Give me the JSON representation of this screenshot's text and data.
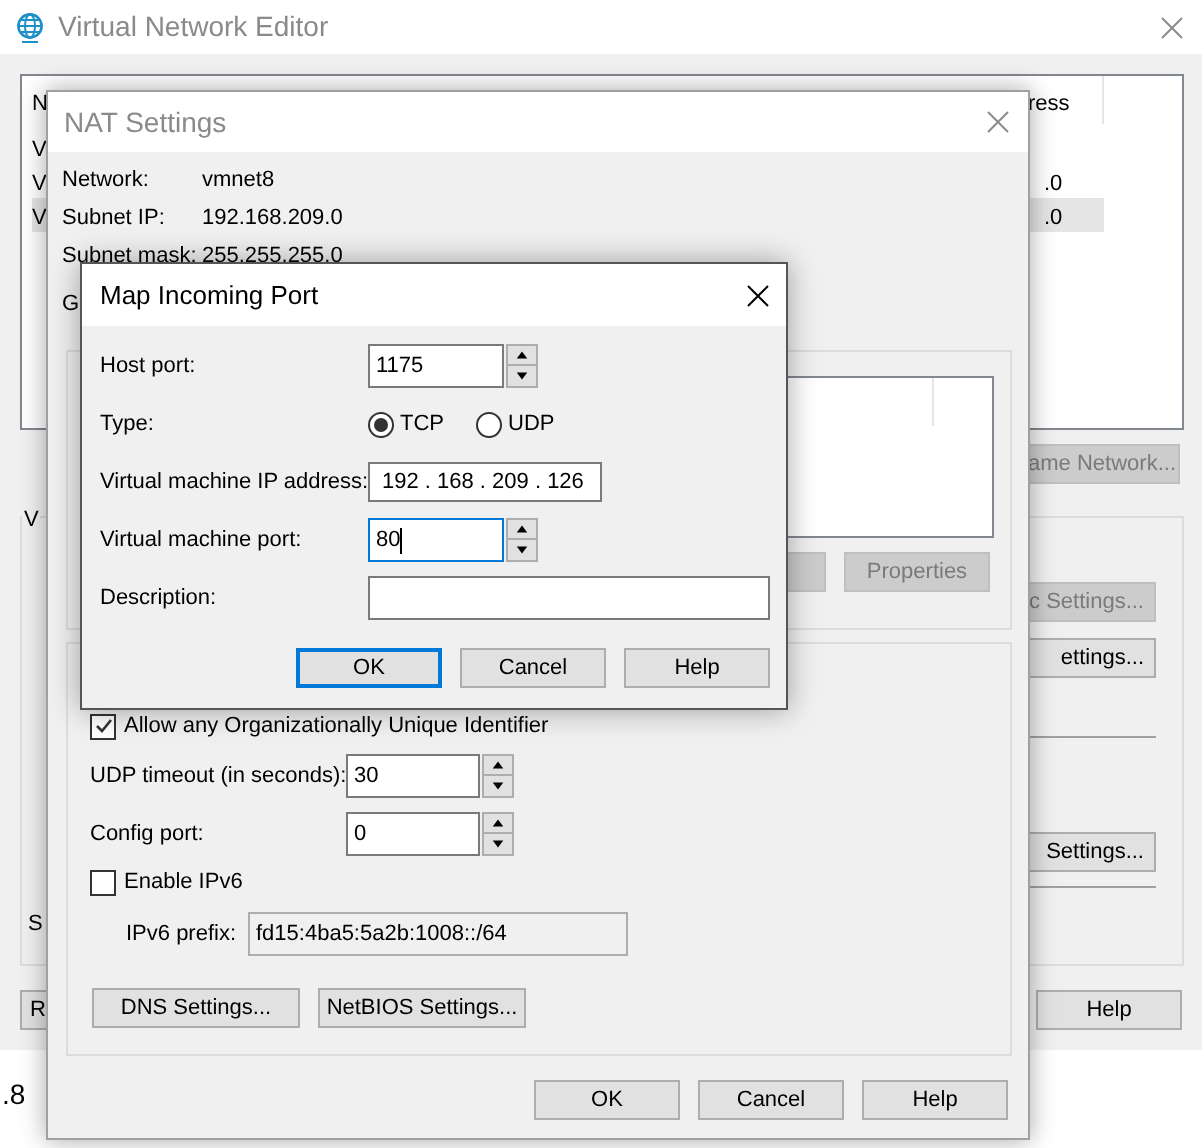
{
  "editor_window": {
    "title": "Virtual Network Editor",
    "list": {
      "column_1": "N",
      "column_4": "ress",
      "rows": [
        {
          "column_1": "V",
          "selected": false
        },
        {
          "column_1": "V",
          "column_4": ".0",
          "selected": false
        },
        {
          "column_1": "V",
          "column_4": ".0",
          "selected": true
        }
      ]
    },
    "rename_button": {
      "label": "ame Network...",
      "disabled": true
    },
    "group_label": "V",
    "group_buttons": [
      {
        "label": "c Settings...",
        "disabled": true
      },
      {
        "label": "ettings...",
        "disabled": false
      },
      {
        "label": "Settings...",
        "disabled": false
      }
    ],
    "side_label": "S",
    "left_button": "R",
    "help_button": "Help"
  },
  "desktop_text": ".8",
  "nat_window": {
    "title": "NAT Settings",
    "info": [
      {
        "label": "Network:",
        "value": "vmnet8"
      },
      {
        "label": "Subnet IP:",
        "value": "192.168.209.0"
      },
      {
        "label": "Subnet mask:",
        "value": "255.255.255.0"
      },
      {
        "label": "G"
      }
    ],
    "port_buttons": [
      {
        "disabled": true
      },
      {
        "label": "Properties",
        "disabled": true
      }
    ],
    "allow_oui": {
      "label": "Allow any Organizationally Unique Identifier",
      "checked": true
    },
    "udp_timeout": {
      "label": "UDP timeout (in seconds):",
      "value": "30"
    },
    "config_port": {
      "label": "Config port:",
      "value": "0"
    },
    "enable_ipv6": {
      "label": "Enable IPv6",
      "checked": false
    },
    "ipv6_prefix": {
      "label": "IPv6 prefix:",
      "value": "fd15:4ba5:5a2b:1008::/64",
      "disabled": true
    },
    "settings_buttons": [
      "DNS Settings...",
      "NetBIOS Settings..."
    ],
    "buttons": [
      "OK",
      "Cancel",
      "Help"
    ]
  },
  "map_dialog": {
    "title": "Map Incoming Port",
    "host_port": {
      "label": "Host port:",
      "value": "1175"
    },
    "type": {
      "label": "Type:",
      "options": [
        {
          "label": "TCP",
          "selected": true
        },
        {
          "label": "UDP",
          "selected": false
        }
      ]
    },
    "vm_ip": {
      "label": "Virtual machine IP address:",
      "value": "192 . 168 . 209 . 126"
    },
    "vm_port": {
      "label": "Virtual machine port:",
      "value": "80",
      "focused": true
    },
    "description": {
      "label": "Description:"
    },
    "buttons": [
      {
        "label": "OK",
        "default": true
      },
      {
        "label": "Cancel",
        "default": false
      },
      {
        "label": "Help",
        "default": false
      }
    ]
  }
}
